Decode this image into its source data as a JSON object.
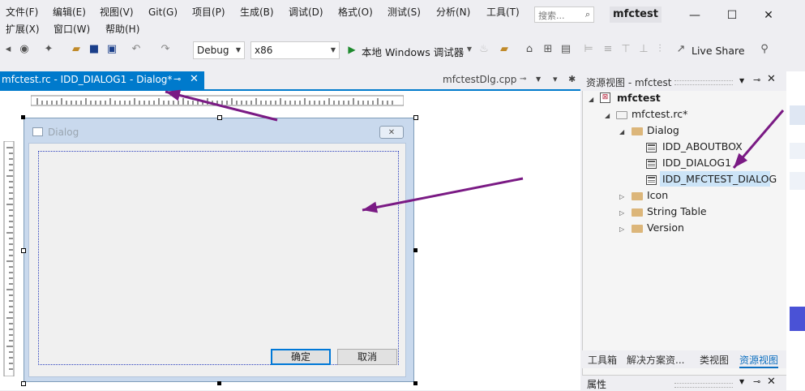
{
  "menubar": {
    "row1": [
      "文件(F)",
      "编辑(E)",
      "视图(V)",
      "Git(G)",
      "项目(P)",
      "生成(B)",
      "调试(D)",
      "格式(O)",
      "测试(S)",
      "分析(N)",
      "工具(T)"
    ],
    "row2": [
      "扩展(X)",
      "窗口(W)",
      "帮助(H)"
    ],
    "search_placeholder": "搜索...",
    "solution_title": "mfctest"
  },
  "toolbar": {
    "config": "Debug",
    "platform": "x86",
    "run_label": "本地 Windows 调试器",
    "live_share": "Live Share"
  },
  "tabs": {
    "active": "mfctest.rc - IDD_DIALOG1 - Dialog*",
    "inactive": "mfctestDlg.cpp"
  },
  "dialog": {
    "title": "Dialog",
    "ok": "确定",
    "cancel": "取消"
  },
  "resource_view": {
    "title": "资源视图 - mfctest",
    "root": "mfctest",
    "rc_file": "mfctest.rc*",
    "dialog_folder": "Dialog",
    "dialogs": [
      "IDD_ABOUTBOX",
      "IDD_DIALOG1",
      "IDD_MFCTEST_DIALOG"
    ],
    "other_folders": [
      "Icon",
      "String Table",
      "Version"
    ]
  },
  "bottom_tabs": [
    "工具箱",
    "解决方案资...",
    "类视图",
    "资源视图"
  ],
  "properties_title": "属性",
  "colors": {
    "accent": "#007acc",
    "annotation_arrow": "#7a1a84"
  }
}
